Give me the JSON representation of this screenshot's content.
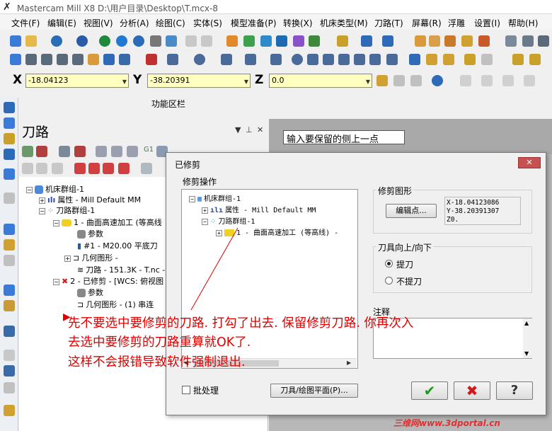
{
  "window": {
    "title": "Mastercam Mill X8  D:\\用户目录\\Desktop\\T.mcx-8"
  },
  "menu": [
    "文件(F)",
    "编辑(E)",
    "视图(V)",
    "分析(A)",
    "绘图(C)",
    "实体(S)",
    "模型准备(P)",
    "转换(X)",
    "机床类型(M)",
    "刀路(T)",
    "屏幕(R)",
    "浮雕",
    "设置(I)",
    "帮助(H)"
  ],
  "coords": {
    "x_label": "X",
    "x_value": "-18.04123",
    "y_label": "Y",
    "y_value": "-38.20391",
    "z_label": "Z",
    "z_value": "0.0"
  },
  "function_area": "功能区栏",
  "toolpath_panel": {
    "title": "刀路",
    "g1": "G1",
    "tree": [
      "机床群组-1",
      "属性 - Mill Default MM",
      "刀路群组-1",
      "1 - 曲面高速加工 (等高线",
      "参数",
      "#1 - M20.00 平底刀",
      "几何图形 -",
      "刀路 - 151.3K - T.nc -",
      "2 - 已修剪 - [WCS: 俯视图",
      "参数",
      "几何图形 - (1) 串连"
    ]
  },
  "graphics": {
    "prompt": "输入要保留的侧上一点"
  },
  "dialog": {
    "title": "已修剪",
    "close": "✕",
    "trim_ops_label": "修剪操作",
    "tree": [
      "机床群组-1",
      "属性 - Mill Default MM",
      "刀路群组-1",
      "1 - 曲面高速加工 (等高线) -"
    ],
    "trim_geom_label": "修剪图形",
    "edit_point_btn": "编辑点...",
    "coord_lines": [
      "X-18.04123086",
      "Y-38.20391307",
      "Z0."
    ],
    "tool_updown_label": "刀具向上/向下",
    "radio_up": "提刀",
    "radio_noup": "不提刀",
    "notes_label": "注释",
    "batch_label": "批处理",
    "tool_plane_btn": "刀具/绘图平面(P)...",
    "ok": "✔",
    "cancel": "✖",
    "help": "?"
  },
  "annotation": [
    "先不要选中要修剪的刀路. 打勾了出去. 保留修剪刀路. 你再次入",
    "去选中要修剪的刀路重算就OK了.",
    "这样不会报错导致软件强制退出."
  ],
  "watermark": "三维网www.3dportal.cn",
  "colors": {
    "field_bg": "#ffffc0",
    "annotation": "#e00000",
    "close_btn": "#c75050"
  }
}
